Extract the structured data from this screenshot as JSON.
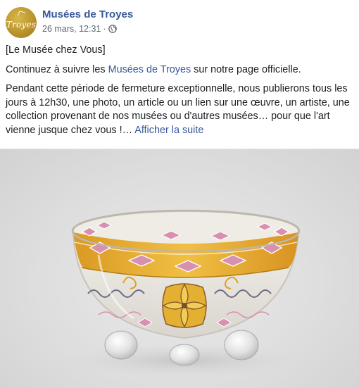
{
  "post": {
    "page_name": "Musées de Troyes",
    "avatar_text": "Troyes",
    "date": "26 mars, 12:31",
    "separator": "·",
    "privacy_icon": "globe-icon",
    "line1": "[Le Musée chez Vous]",
    "line2_prefix": "Continuez à suivre les ",
    "line2_link": "Musées de Troyes",
    "line2_suffix": " sur notre page officielle.",
    "paragraph": "Pendant cette période de fermeture exceptionnelle, nous publierons tous les jours à 12h30, une photo, un article ou un lien sur une œuvre, un artiste, une collection provenant de nos musées ou d'autres musées… pour que l'art vienne jusque chez vous !…",
    "see_more": "Afficher la suite"
  },
  "colors": {
    "link": "#385898",
    "meta": "#606770",
    "avatar_gold": "#b8902a",
    "bowl_band": "#e6a81e",
    "bowl_diamond": "#d98fb0"
  }
}
